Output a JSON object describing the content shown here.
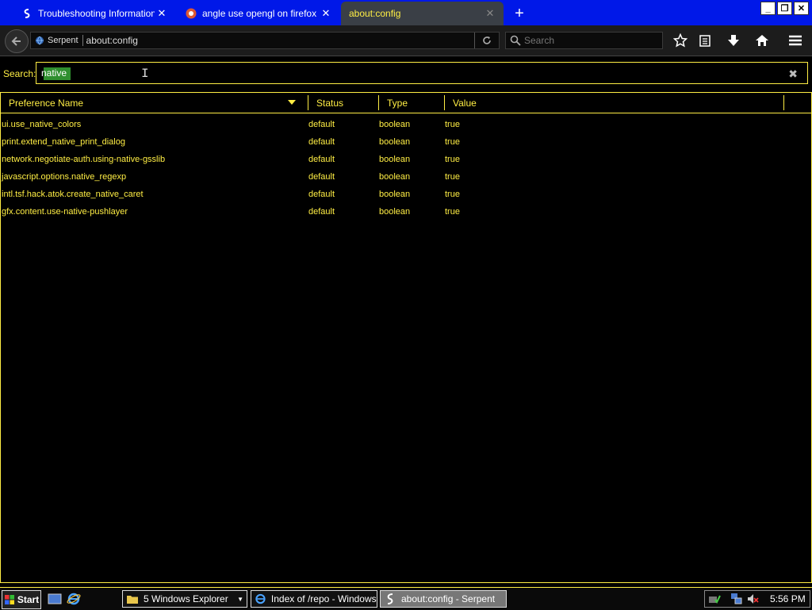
{
  "tabs": [
    {
      "title": "Troubleshooting Information",
      "icon": "serpent-icon"
    },
    {
      "title": "angle use opengl on firefox at D",
      "icon": "duckduckgo-icon"
    },
    {
      "title": "about:config",
      "icon": "none"
    }
  ],
  "navbar": {
    "identity": "Serpent",
    "url": "about:config",
    "search_placeholder": "Search"
  },
  "config_search": {
    "label": "Search:",
    "value": "native"
  },
  "table": {
    "columns": [
      "Preference Name",
      "Status",
      "Type",
      "Value"
    ],
    "rows": [
      {
        "name": "ui.use_native_colors",
        "status": "default",
        "type": "boolean",
        "value": "true"
      },
      {
        "name": "print.extend_native_print_dialog",
        "status": "default",
        "type": "boolean",
        "value": "true"
      },
      {
        "name": "network.negotiate-auth.using-native-gsslib",
        "status": "default",
        "type": "boolean",
        "value": "true"
      },
      {
        "name": "javascript.options.native_regexp",
        "status": "default",
        "type": "boolean",
        "value": "true"
      },
      {
        "name": "intl.tsf.hack.atok.create_native_caret",
        "status": "default",
        "type": "boolean",
        "value": "true"
      },
      {
        "name": "gfx.content.use-native-pushlayer",
        "status": "default",
        "type": "boolean",
        "value": "true"
      }
    ]
  },
  "taskbar": {
    "start": "Start",
    "items": [
      "5 Windows Explorer",
      "Index of /repo - Windows...",
      "about:config - Serpent"
    ],
    "clock": "5:56 PM"
  },
  "colors": {
    "accent": "#ffee44",
    "titlebar": "#0018e8",
    "highlight": "#2f8f2f"
  }
}
